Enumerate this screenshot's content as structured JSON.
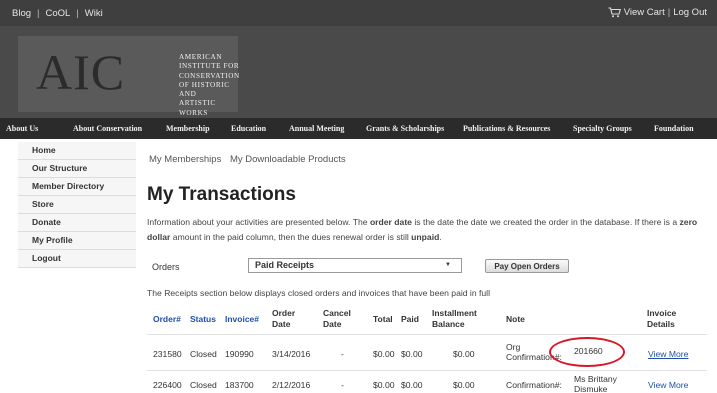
{
  "topbar": {
    "blog": "Blog",
    "cool": "CoOL",
    "wiki": "Wiki",
    "view_cart": "View Cart",
    "log_out": "Log Out",
    "icon": "cart-icon"
  },
  "banner": {
    "letters": "AIC",
    "name_lines": [
      "AMERICAN",
      "INSTITUTE FOR",
      "CONSERVATION",
      "OF HISTORIC AND",
      "ARTISTIC WORKS"
    ]
  },
  "nav": [
    "About Us",
    "About Conservation",
    "Membership",
    "Education",
    "Annual Meeting",
    "Grants & Scholarships",
    "Publications & Resources",
    "Specialty Groups",
    "Foundation"
  ],
  "sidebar": [
    "Home",
    "Our Structure",
    "Member Directory",
    "Store",
    "Donate",
    "My Profile",
    "Logout"
  ],
  "sub_links": [
    "My Memberships",
    "My Downloadable Products"
  ],
  "page_title": "My Transactions",
  "intro": {
    "p1": "Information about your activities are presented below. The ",
    "b1": "order date",
    "p2": " is the date the date we created the order in the database. If there is a ",
    "b2": "zero dollar",
    "p3": " amount in the paid column, then the dues renewal order is still ",
    "b3": "unpaid",
    "p4": "."
  },
  "orders_filter": {
    "label": "Orders",
    "selected": "Paid Receipts",
    "pay_button": "Pay Open Orders"
  },
  "receipts_note": "The Receipts section below displays closed orders and invoices that have been paid in full",
  "table": {
    "headers": {
      "order": "Order#",
      "status": "Status",
      "invoice": "Invoice#",
      "order_date": [
        "Order",
        "Date"
      ],
      "cancel_date": [
        "Cancel",
        "Date"
      ],
      "total": "Total",
      "paid": "Paid",
      "installment": [
        "Installment",
        "Balance"
      ],
      "note": "Note",
      "invoice_details": [
        "Invoice",
        "Details"
      ]
    },
    "rows": [
      {
        "order": "231580",
        "status": "Closed",
        "invoice": "190990",
        "order_date": "3/14/2016",
        "cancel_date": "-",
        "total": "$0.00",
        "paid": "$0.00",
        "installment": "$0.00",
        "note_label": [
          "Org",
          "Confirmation#:"
        ],
        "note_value": "201660",
        "details": "View More"
      },
      {
        "order": "226400",
        "status": "Closed",
        "invoice": "183700",
        "order_date": "2/12/2016",
        "cancel_date": "-",
        "total": "$0.00",
        "paid": "$0.00",
        "installment": "$0.00",
        "note_label": [
          "Confirmation#:"
        ],
        "note_value": [
          "Ms Brittany",
          "Dismuke"
        ],
        "details": "View More"
      }
    ]
  },
  "colors": {
    "link_blue": "#1f4fa8",
    "highlight_red": "#d7182a",
    "nav_bg": "#2b2b2b"
  }
}
